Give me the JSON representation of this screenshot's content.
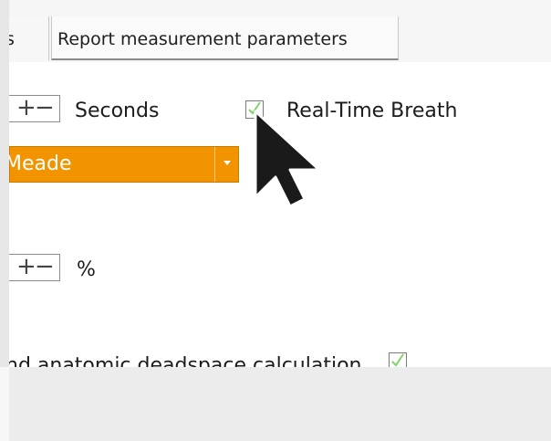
{
  "tabs": {
    "previous_label": "s",
    "active_label": "Report measurement parameters"
  },
  "time_row": {
    "unit_label": "Seconds",
    "realtime_label": "Real-Time Breath",
    "realtime_checked": true
  },
  "method_dropdown": {
    "value": "Meade"
  },
  "percent_row": {
    "unit_label": "%"
  },
  "deadspace_row": {
    "label": "nd anatomic deadspace calculation",
    "checked": true
  },
  "colors": {
    "accent": "#f29400",
    "check": "#7fd46a"
  },
  "icons": {
    "spinner": "plus-minus-icon",
    "dropdown": "caret-down-icon",
    "cursor": "mouse-pointer-icon"
  }
}
